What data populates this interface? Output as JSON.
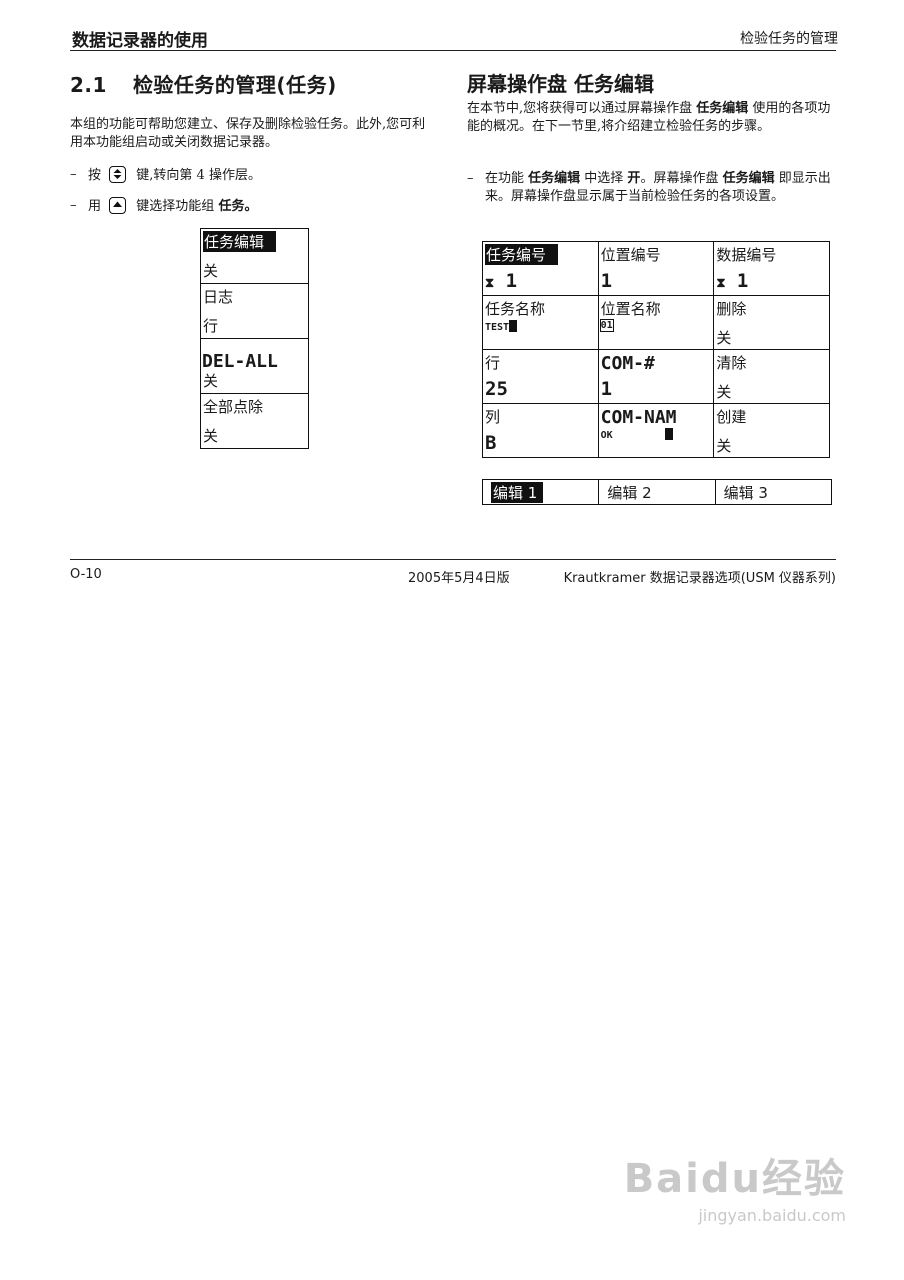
{
  "header": {
    "left": "数据记录器的使用",
    "right": "检验任务的管理"
  },
  "left": {
    "section_number": "2.1",
    "section_title": "检验任务的管理(任务)",
    "intro": "本组的功能可帮助您建立、保存及删除检验任务。此外,您可利用本功能组启动或关闭数据记录器。",
    "bullets": [
      {
        "pre": "按",
        "post": "键,转向第 4 操作层。"
      },
      {
        "pre": "用",
        "post": "键选择功能组",
        "bold": "任务。"
      }
    ],
    "menu": [
      {
        "label": "任务编辑",
        "value": "关"
      },
      {
        "label": "日志",
        "value": "行"
      },
      {
        "label": "DEL-ALL",
        "value": "关"
      },
      {
        "label": "全部点除",
        "value": "关"
      }
    ]
  },
  "right": {
    "title": "屏幕操作盘  任务编辑",
    "intro": "在本节中,您将获得可以通过屏幕操作盘 任务编辑 使用的各项功能的概况。在下一节里,将介绍建立检验任务的步骤。",
    "intro_parts": [
      "在本节中,您将获得可以通过屏幕操作盘 ",
      "任务编辑",
      " 使用的各项功能的概况。在下一节里,将介绍建立检验任务的步骤。"
    ],
    "bullet_parts": [
      "在功能 ",
      "任务编辑",
      " 中选择 ",
      "开",
      "。屏幕操作盘 ",
      "任务编辑",
      " 即显示出来。屏幕操作盘显示属于当前检验任务的各项设置。"
    ],
    "grid": [
      [
        {
          "label": "任务编号",
          "value": "1"
        },
        {
          "label": "位置编号",
          "value": "1"
        },
        {
          "label": "数据编号",
          "value": "1"
        }
      ],
      [
        {
          "label": "任务名称",
          "value": "TEST"
        },
        {
          "label": "位置名称",
          "value": "01"
        },
        {
          "label": "删除",
          "value": "关"
        }
      ],
      [
        {
          "label": "行",
          "value": "25"
        },
        {
          "label": "COM-#",
          "value": "1"
        },
        {
          "label": "清除",
          "value": "关"
        }
      ],
      [
        {
          "label": "列",
          "value": "B"
        },
        {
          "label": "COM-NAM",
          "value": "OK"
        },
        {
          "label": "创建",
          "value": "关"
        }
      ]
    ],
    "tabs": [
      "编辑 1",
      "编辑 2",
      "编辑 3"
    ]
  },
  "footer": {
    "page": "O-10",
    "date": "2005年5月4日版",
    "brand": "Krautkramer",
    "doc": "数据记录器选项(USM 仪器系列)"
  },
  "watermark": {
    "logo": "Baidu经验",
    "url": "jingyan.baidu.com"
  }
}
